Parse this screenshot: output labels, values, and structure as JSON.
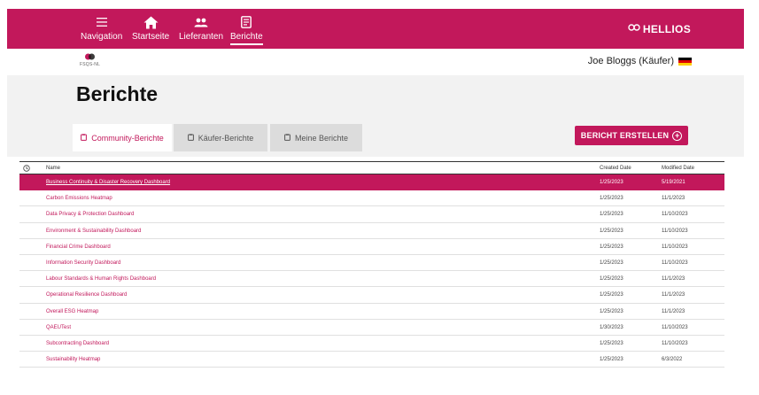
{
  "nav": {
    "items": [
      {
        "label": "Navigation",
        "icon": "hamburger-icon"
      },
      {
        "label": "Startseite",
        "icon": "home-icon"
      },
      {
        "label": "Lieferanten",
        "icon": "people-icon"
      },
      {
        "label": "Berichte",
        "icon": "reports-icon"
      }
    ],
    "brand": "HELLIOS",
    "accent_color": "#c2185b"
  },
  "subheader": {
    "logo_text": "FSQS-NL",
    "user": "Joe Bloggs (Käufer)"
  },
  "page": {
    "title": "Berichte",
    "tabs": [
      {
        "label": "Community-Berichte",
        "active": true
      },
      {
        "label": "Käufer-Berichte",
        "active": false
      },
      {
        "label": "Meine Berichte",
        "active": false
      }
    ],
    "create_button": "BERICHT ERSTELLEN"
  },
  "table": {
    "headers": {
      "name": "Name",
      "created": "Created Date",
      "modified": "Modified Date"
    },
    "rows": [
      {
        "name": "Business Continuity & Disaster Recovery Dashboard",
        "created": "1/25/2023",
        "modified": "5/19/2021",
        "selected": true
      },
      {
        "name": "Carbon Emissions Heatmap",
        "created": "1/25/2023",
        "modified": "11/1/2023"
      },
      {
        "name": "Data Privacy & Protection Dashboard",
        "created": "1/25/2023",
        "modified": "11/10/2023"
      },
      {
        "name": "Environment & Sustainability Dashboard",
        "created": "1/25/2023",
        "modified": "11/10/2023"
      },
      {
        "name": "Financial Crime Dashboard",
        "created": "1/25/2023",
        "modified": "11/10/2023"
      },
      {
        "name": "Information Security Dashboard",
        "created": "1/25/2023",
        "modified": "11/10/2023"
      },
      {
        "name": "Labour Standards & Human Rights Dashboard",
        "created": "1/25/2023",
        "modified": "11/1/2023"
      },
      {
        "name": "Operational Resilience Dashboard",
        "created": "1/25/2023",
        "modified": "11/1/2023"
      },
      {
        "name": "Overall ESG Heatmap",
        "created": "1/25/2023",
        "modified": "11/1/2023"
      },
      {
        "name": "QAEUTest",
        "created": "1/30/2023",
        "modified": "11/10/2023"
      },
      {
        "name": "Subcontracting Dashboard",
        "created": "1/25/2023",
        "modified": "11/10/2023"
      },
      {
        "name": "Sustainability Heatmap",
        "created": "1/25/2023",
        "modified": "6/3/2022"
      }
    ]
  }
}
